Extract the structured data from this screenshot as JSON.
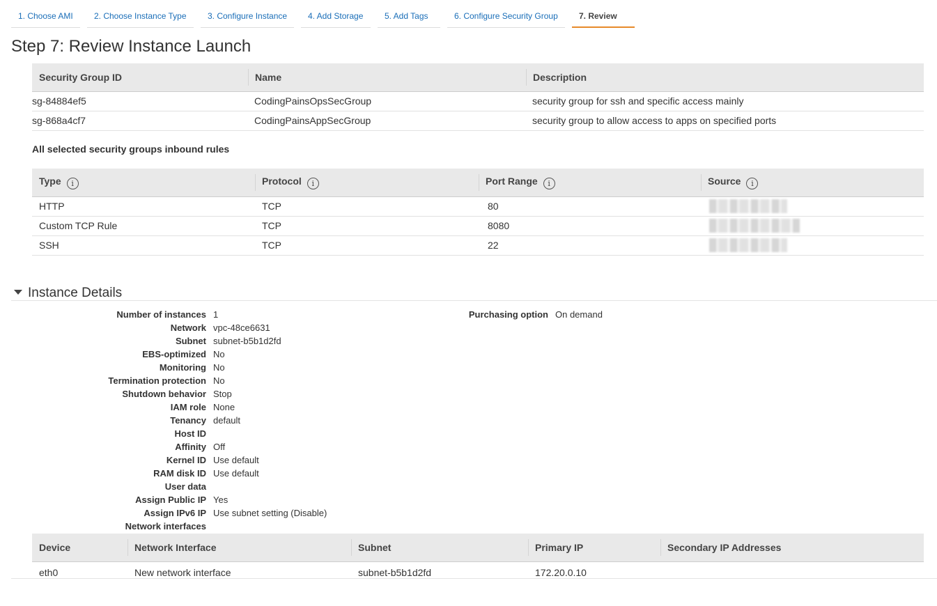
{
  "steps": [
    {
      "label": "1. Choose AMI",
      "active": false
    },
    {
      "label": "2. Choose Instance Type",
      "active": false
    },
    {
      "label": "3. Configure Instance",
      "active": false
    },
    {
      "label": "4. Add Storage",
      "active": false
    },
    {
      "label": "5. Add Tags",
      "active": false
    },
    {
      "label": "6. Configure Security Group",
      "active": false
    },
    {
      "label": "7. Review",
      "active": true
    }
  ],
  "page_title": "Step 7: Review Instance Launch",
  "security_groups": {
    "headers": [
      "Security Group ID",
      "Name",
      "Description"
    ],
    "rows": [
      [
        "sg-84884ef5",
        "CodingPainsOpsSecGroup",
        "security group for ssh and specific access mainly"
      ],
      [
        "sg-868a4cf7",
        "CodingPainsAppSecGroup",
        "security group to allow access to apps on specified ports"
      ]
    ]
  },
  "inbound_rules_heading": "All selected security groups inbound rules",
  "inbound_rules": {
    "headers": [
      "Type",
      "Protocol",
      "Port Range",
      "Source"
    ],
    "info_icon_glyph": "i",
    "rows": [
      [
        "HTTP",
        "TCP",
        "80"
      ],
      [
        "Custom TCP Rule",
        "TCP",
        "8080"
      ],
      [
        "SSH",
        "TCP",
        "22"
      ]
    ]
  },
  "instance_details": {
    "title": "Instance Details",
    "fields": [
      [
        "Number of instances",
        "1"
      ],
      [
        "Network",
        "vpc-48ce6631"
      ],
      [
        "Subnet",
        "subnet-b5b1d2fd"
      ],
      [
        "EBS-optimized",
        "No"
      ],
      [
        "Monitoring",
        "No"
      ],
      [
        "Termination protection",
        "No"
      ],
      [
        "Shutdown behavior",
        "Stop"
      ],
      [
        "IAM role",
        "None"
      ],
      [
        "Tenancy",
        "default"
      ],
      [
        "Host ID",
        ""
      ],
      [
        "Affinity",
        "Off"
      ],
      [
        "Kernel ID",
        "Use default"
      ],
      [
        "RAM disk ID",
        "Use default"
      ],
      [
        "User data",
        ""
      ],
      [
        "Assign Public IP",
        "Yes"
      ],
      [
        "Assign IPv6 IP",
        "Use subnet setting (Disable)"
      ],
      [
        "Network interfaces",
        ""
      ]
    ],
    "purchasing_option_label": "Purchasing option",
    "purchasing_option_value": "On demand"
  },
  "network_interfaces": {
    "headers": [
      "Device",
      "Network Interface",
      "Subnet",
      "Primary IP",
      "Secondary IP Addresses"
    ],
    "rows": [
      [
        "eth0",
        "New network interface",
        "subnet-b5b1d2fd",
        "172.20.0.10",
        ""
      ]
    ]
  },
  "colors": {
    "link": "#1a6eb8",
    "active_step_underline": "#e78a2a",
    "table_header_bg": "#e9e9e9"
  }
}
